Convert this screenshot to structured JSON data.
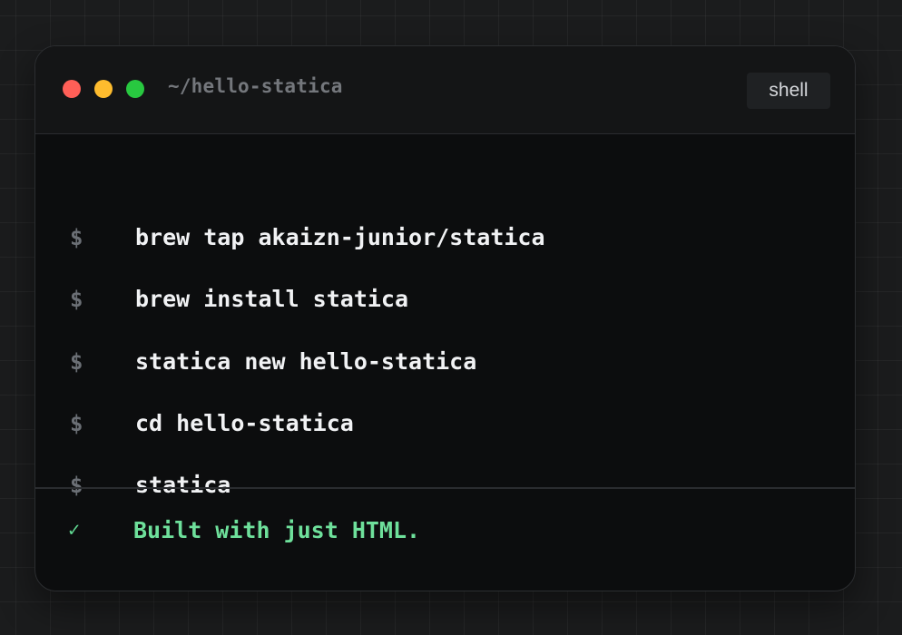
{
  "window": {
    "title": "~/hello-statica",
    "badge": "shell",
    "controls": [
      "close",
      "minimize",
      "maximize"
    ]
  },
  "commands": [
    {
      "prompt": "$",
      "text": "brew tap akaizn-junior/statica"
    },
    {
      "prompt": "$",
      "text": "brew install statica"
    },
    {
      "prompt": "$",
      "text": "statica new hello-statica"
    },
    {
      "prompt": "$",
      "text": "cd hello-statica"
    },
    {
      "prompt": "$",
      "text": "statica"
    }
  ],
  "status": {
    "icon": "✓",
    "text": "Built with just HTML."
  },
  "colors": {
    "close": "#ff5f57",
    "minimize": "#febc2e",
    "maximize": "#28c840",
    "success": "#6ee09b"
  }
}
